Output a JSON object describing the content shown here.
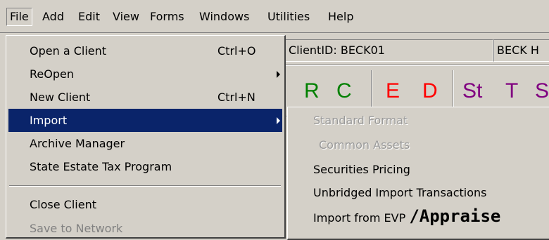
{
  "menubar": {
    "items": [
      "File",
      "Add",
      "Edit",
      "View",
      "Forms",
      "Windows",
      "Utilities",
      "Help"
    ]
  },
  "client": {
    "id_text": "ClientID: BECK01",
    "name_text": "BECK H"
  },
  "toolbar": {
    "buttons": [
      {
        "label": "R",
        "color": "#008000"
      },
      {
        "label": "C",
        "color": "#008000"
      },
      {
        "label": "E",
        "color": "#ff0000"
      },
      {
        "label": "D",
        "color": "#ff0000"
      },
      {
        "label": "St",
        "color": "#800080"
      },
      {
        "label": "T",
        "color": "#800080"
      },
      {
        "label": "S",
        "color": "#800080"
      }
    ]
  },
  "file_menu": {
    "items": [
      {
        "label": "Open a Client",
        "shortcut": "Ctrl+O"
      },
      {
        "label": "ReOpen",
        "has_submenu": true
      },
      {
        "label": "New Client",
        "shortcut": "Ctrl+N"
      },
      {
        "label": "Import",
        "has_submenu": true,
        "highlighted": true
      },
      {
        "label": "Archive Manager"
      },
      {
        "label": "State Estate Tax Program"
      },
      {
        "label": "Close Client"
      },
      {
        "label": "Save to Network",
        "disabled": true
      }
    ]
  },
  "import_submenu": {
    "items": [
      {
        "label": "Standard Format",
        "disabled": true
      },
      {
        "label": "Common Assets",
        "disabled": true
      },
      {
        "label": "Securities Pricing"
      },
      {
        "label": "Unbridged Import Transactions"
      },
      {
        "label": "Import from EVP",
        "suffix": "/Appraise"
      }
    ]
  },
  "colors": {
    "menu_bg": "#d4d0c8",
    "highlight": "#0a246a",
    "disabled_text": "#808080"
  }
}
